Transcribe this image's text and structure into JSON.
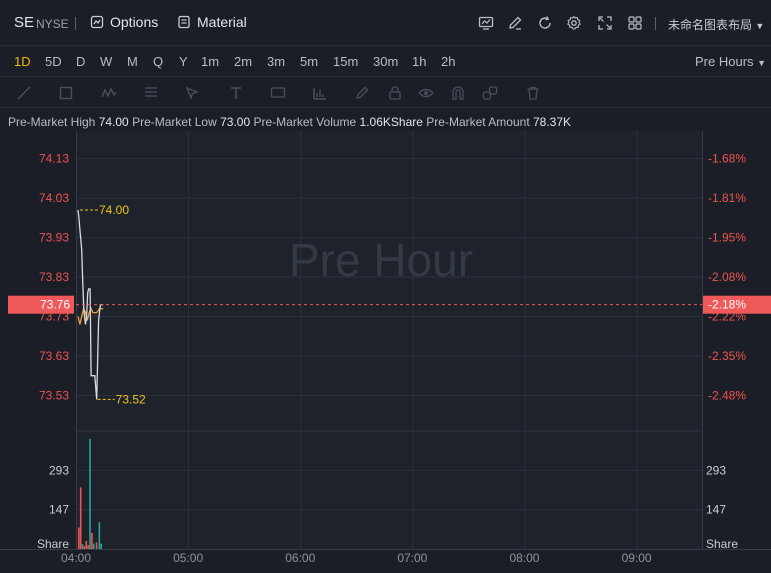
{
  "header": {
    "symbol": "SE",
    "exchange": "NYSE",
    "options_label": "Options",
    "material_label": "Material",
    "layout_name": "未命名图表布局",
    "icons": [
      "chart-icon",
      "edit-icon",
      "refresh-icon",
      "gear-icon",
      "fullscreen-icon",
      "grid-icon"
    ]
  },
  "periods": {
    "items": [
      "1D",
      "5D",
      "D",
      "W",
      "M",
      "Q",
      "Y",
      "1m",
      "2m",
      "3m",
      "5m",
      "15m",
      "30m",
      "1h",
      "2h"
    ],
    "active": "1D",
    "session_label": "Pre Hours"
  },
  "info": {
    "high_label": "Pre-Market High",
    "high_value": "74.00",
    "low_label": "Pre-Market Low",
    "low_value": "73.00",
    "volume_label": "Pre-Market Volume",
    "volume_value": "1.06KShare",
    "amount_label": "Pre-Market Amount",
    "amount_value": "78.37K"
  },
  "chart_data": {
    "type": "line",
    "watermark": "Pre Hour",
    "colors": {
      "up": "#26a69a",
      "down": "#ef5350",
      "price_line": "#d8dbe2",
      "avg_line": "#f0a13a",
      "marker": "#f0c419",
      "current": "#f05959",
      "volume_up": "#26a69a",
      "volume_down": "#ef5350"
    },
    "price_axis": {
      "ticks": [
        74.13,
        74.03,
        73.93,
        73.83,
        73.73,
        73.63,
        73.53
      ],
      "tick_labels": [
        "74.13",
        "74.03",
        "73.93",
        "73.83",
        "73.73",
        "73.63",
        "73.53"
      ],
      "ylim": [
        73.44,
        74.2
      ]
    },
    "percent_axis": {
      "tick_labels": [
        "-1.68%",
        "-1.81%",
        "-1.95%",
        "-2.08%",
        "-2.22%",
        "-2.35%",
        "-2.48%"
      ]
    },
    "x_axis": {
      "tick_labels": [
        "04:00",
        "05:00",
        "06:00",
        "07:00",
        "08:00",
        "09:00"
      ],
      "minutes_range": [
        0,
        335
      ]
    },
    "current_price": {
      "value": 73.76,
      "label": "73.76",
      "pct_label": "-2.18%"
    },
    "high_marker": {
      "value": 74.0,
      "label": "74.00"
    },
    "low_marker": {
      "value": 73.52,
      "label": "73.52"
    },
    "price_series": [
      {
        "t": 0.0,
        "v": 74.0
      },
      {
        "t": 0.5,
        "v": 73.98
      },
      {
        "t": 1.0,
        "v": 73.95
      },
      {
        "t": 2.0,
        "v": 73.9
      },
      {
        "t": 2.5,
        "v": 73.82
      },
      {
        "t": 3.0,
        "v": 73.76
      },
      {
        "t": 3.5,
        "v": 73.73
      },
      {
        "t": 4.0,
        "v": 73.71
      },
      {
        "t": 4.6,
        "v": 73.73
      },
      {
        "t": 5.2,
        "v": 73.79
      },
      {
        "t": 5.7,
        "v": 73.8
      },
      {
        "t": 6.5,
        "v": 73.8
      },
      {
        "t": 7.0,
        "v": 73.58
      },
      {
        "t": 8.0,
        "v": 73.58
      },
      {
        "t": 9.0,
        "v": 73.58
      },
      {
        "t": 10.0,
        "v": 73.52
      },
      {
        "t": 11.0,
        "v": 73.72
      },
      {
        "t": 12.0,
        "v": 73.76
      },
      {
        "t": 13.5,
        "v": 73.76
      }
    ],
    "avg_series": [
      {
        "t": 0.0,
        "v": 73.73
      },
      {
        "t": 1.0,
        "v": 73.71
      },
      {
        "t": 2.0,
        "v": 73.73
      },
      {
        "t": 3.0,
        "v": 73.75
      },
      {
        "t": 4.0,
        "v": 73.74
      },
      {
        "t": 5.0,
        "v": 73.72
      },
      {
        "t": 6.0,
        "v": 73.74
      },
      {
        "t": 7.0,
        "v": 73.75
      },
      {
        "t": 8.0,
        "v": 73.74
      },
      {
        "t": 9.0,
        "v": 73.74
      },
      {
        "t": 10.0,
        "v": 73.74
      },
      {
        "t": 11.5,
        "v": 73.75
      },
      {
        "t": 13.5,
        "v": 73.75
      }
    ],
    "volume_axis": {
      "tick_labels": [
        "293",
        "147",
        "Share"
      ],
      "ticks": [
        293,
        147
      ],
      "ylim": [
        0,
        440
      ]
    },
    "volume_series": [
      {
        "t": 0.0,
        "v": 80,
        "dir": "down"
      },
      {
        "t": 1.0,
        "v": 230,
        "dir": "down"
      },
      {
        "t": 2.0,
        "v": 18,
        "dir": "up"
      },
      {
        "t": 3.0,
        "v": 10,
        "dir": "down"
      },
      {
        "t": 4.0,
        "v": 30,
        "dir": "down"
      },
      {
        "t": 5.0,
        "v": 15,
        "dir": "down"
      },
      {
        "t": 6.0,
        "v": 410,
        "dir": "up"
      },
      {
        "t": 7.0,
        "v": 60,
        "dir": "down"
      },
      {
        "t": 8.0,
        "v": 20,
        "dir": "up"
      },
      {
        "t": 9.5,
        "v": 25,
        "dir": "down"
      },
      {
        "t": 11.0,
        "v": 100,
        "dir": "up"
      },
      {
        "t": 12.0,
        "v": 20,
        "dir": "up"
      }
    ]
  }
}
